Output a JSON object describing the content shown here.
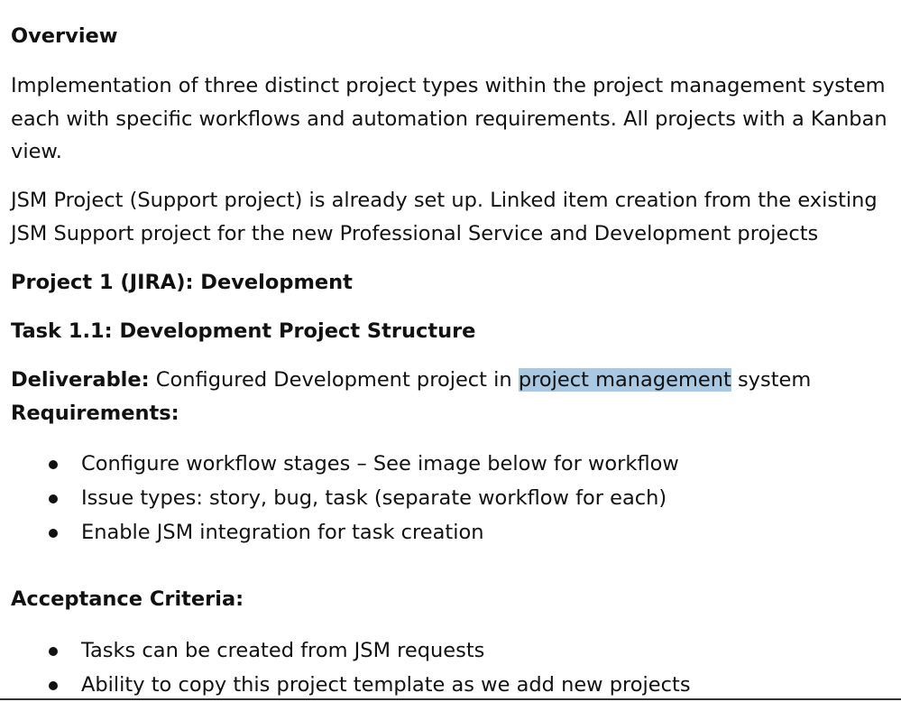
{
  "overview": {
    "heading": "Overview",
    "para1_line1": "Implementation of three distinct project types within the project management system",
    "para1_line2": "each with specific workflows and automation requirements. All projects with a Kanban",
    "para1_line3": "view.",
    "para2_line1": "JSM Project (Support project) is already set up. Linked item creation from the existing",
    "para2_line2": "JSM Support project for the new Professional Service and Development projects"
  },
  "project1": {
    "heading": "Project 1 (JIRA): Development",
    "task_heading": "Task 1.1: Development Project Structure",
    "deliverable_label": "Deliverable:",
    "deliverable_text_before": " Configured Development project in ",
    "deliverable_highlight": "project management",
    "deliverable_text_after": " system",
    "requirements_label": "Requirements:",
    "requirements": [
      "Configure workflow stages – See image below for workflow",
      "Issue types: story, bug, task (separate workflow for each)",
      "Enable JSM integration for task creation"
    ],
    "acceptance_label": "Acceptance Criteria:",
    "acceptance": [
      "Tasks can be created from JSM requests",
      "Ability to copy this project template as we add new projects"
    ]
  }
}
